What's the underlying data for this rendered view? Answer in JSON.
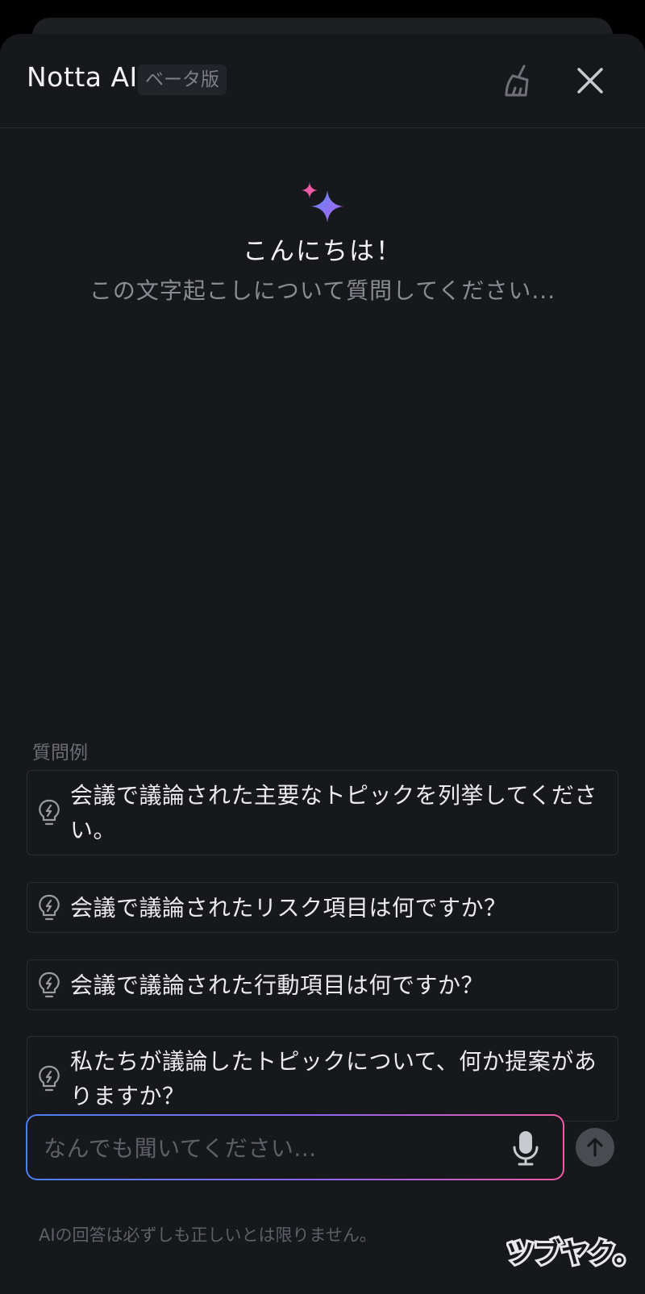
{
  "header": {
    "title": "Notta AI",
    "badge": "ベータ版"
  },
  "hero": {
    "greeting": "こんにちは！",
    "subtext": "この文字起こしについて質問してください..."
  },
  "examples": {
    "label": "質問例",
    "items": [
      {
        "text": "会議で議論された主要なトピックを列挙してください。"
      },
      {
        "text": "会議で議論されたリスク項目は何ですか？"
      },
      {
        "text": "会議で議論された行動項目は何ですか？"
      },
      {
        "text": "私たちが議論したトピックについて、何か提案がありますか？"
      }
    ]
  },
  "input": {
    "value": "",
    "placeholder": "なんでも聞いてください..."
  },
  "disclaimer": "AIの回答は必ずしも正しいとは限りません。",
  "watermark": "ツブヤク。",
  "colors": {
    "background": "#17181c",
    "accent_blue": "#4a7ff2",
    "accent_purple": "#8f64f0",
    "accent_pink": "#ef5aa3"
  },
  "icons": {
    "clear": "broom-icon",
    "close": "close-icon",
    "hero": "sparkle-icon",
    "example": "lightbulb-icon",
    "mic": "microphone-icon",
    "send": "arrow-up-icon"
  }
}
